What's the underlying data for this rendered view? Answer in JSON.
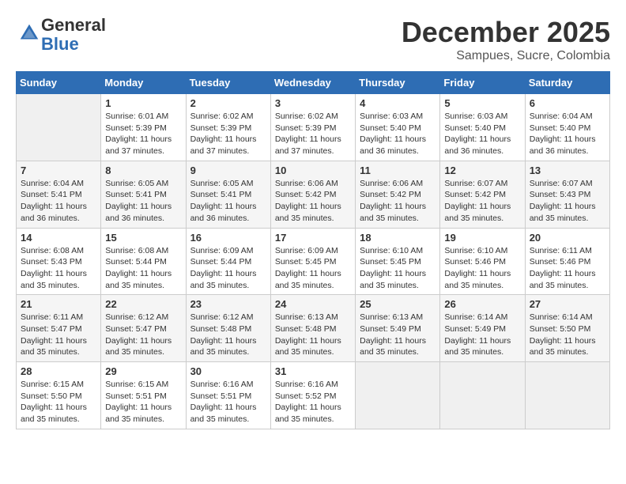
{
  "header": {
    "logo_line1": "General",
    "logo_line2": "Blue",
    "month_title": "December 2025",
    "location": "Sampues, Sucre, Colombia"
  },
  "days_of_week": [
    "Sunday",
    "Monday",
    "Tuesday",
    "Wednesday",
    "Thursday",
    "Friday",
    "Saturday"
  ],
  "weeks": [
    [
      {
        "day": "",
        "sunrise": "",
        "sunset": "",
        "daylight": ""
      },
      {
        "day": "1",
        "sunrise": "Sunrise: 6:01 AM",
        "sunset": "Sunset: 5:39 PM",
        "daylight": "Daylight: 11 hours and 37 minutes."
      },
      {
        "day": "2",
        "sunrise": "Sunrise: 6:02 AM",
        "sunset": "Sunset: 5:39 PM",
        "daylight": "Daylight: 11 hours and 37 minutes."
      },
      {
        "day": "3",
        "sunrise": "Sunrise: 6:02 AM",
        "sunset": "Sunset: 5:39 PM",
        "daylight": "Daylight: 11 hours and 37 minutes."
      },
      {
        "day": "4",
        "sunrise": "Sunrise: 6:03 AM",
        "sunset": "Sunset: 5:40 PM",
        "daylight": "Daylight: 11 hours and 36 minutes."
      },
      {
        "day": "5",
        "sunrise": "Sunrise: 6:03 AM",
        "sunset": "Sunset: 5:40 PM",
        "daylight": "Daylight: 11 hours and 36 minutes."
      },
      {
        "day": "6",
        "sunrise": "Sunrise: 6:04 AM",
        "sunset": "Sunset: 5:40 PM",
        "daylight": "Daylight: 11 hours and 36 minutes."
      }
    ],
    [
      {
        "day": "7",
        "sunrise": "Sunrise: 6:04 AM",
        "sunset": "Sunset: 5:41 PM",
        "daylight": "Daylight: 11 hours and 36 minutes."
      },
      {
        "day": "8",
        "sunrise": "Sunrise: 6:05 AM",
        "sunset": "Sunset: 5:41 PM",
        "daylight": "Daylight: 11 hours and 36 minutes."
      },
      {
        "day": "9",
        "sunrise": "Sunrise: 6:05 AM",
        "sunset": "Sunset: 5:41 PM",
        "daylight": "Daylight: 11 hours and 36 minutes."
      },
      {
        "day": "10",
        "sunrise": "Sunrise: 6:06 AM",
        "sunset": "Sunset: 5:42 PM",
        "daylight": "Daylight: 11 hours and 35 minutes."
      },
      {
        "day": "11",
        "sunrise": "Sunrise: 6:06 AM",
        "sunset": "Sunset: 5:42 PM",
        "daylight": "Daylight: 11 hours and 35 minutes."
      },
      {
        "day": "12",
        "sunrise": "Sunrise: 6:07 AM",
        "sunset": "Sunset: 5:42 PM",
        "daylight": "Daylight: 11 hours and 35 minutes."
      },
      {
        "day": "13",
        "sunrise": "Sunrise: 6:07 AM",
        "sunset": "Sunset: 5:43 PM",
        "daylight": "Daylight: 11 hours and 35 minutes."
      }
    ],
    [
      {
        "day": "14",
        "sunrise": "Sunrise: 6:08 AM",
        "sunset": "Sunset: 5:43 PM",
        "daylight": "Daylight: 11 hours and 35 minutes."
      },
      {
        "day": "15",
        "sunrise": "Sunrise: 6:08 AM",
        "sunset": "Sunset: 5:44 PM",
        "daylight": "Daylight: 11 hours and 35 minutes."
      },
      {
        "day": "16",
        "sunrise": "Sunrise: 6:09 AM",
        "sunset": "Sunset: 5:44 PM",
        "daylight": "Daylight: 11 hours and 35 minutes."
      },
      {
        "day": "17",
        "sunrise": "Sunrise: 6:09 AM",
        "sunset": "Sunset: 5:45 PM",
        "daylight": "Daylight: 11 hours and 35 minutes."
      },
      {
        "day": "18",
        "sunrise": "Sunrise: 6:10 AM",
        "sunset": "Sunset: 5:45 PM",
        "daylight": "Daylight: 11 hours and 35 minutes."
      },
      {
        "day": "19",
        "sunrise": "Sunrise: 6:10 AM",
        "sunset": "Sunset: 5:46 PM",
        "daylight": "Daylight: 11 hours and 35 minutes."
      },
      {
        "day": "20",
        "sunrise": "Sunrise: 6:11 AM",
        "sunset": "Sunset: 5:46 PM",
        "daylight": "Daylight: 11 hours and 35 minutes."
      }
    ],
    [
      {
        "day": "21",
        "sunrise": "Sunrise: 6:11 AM",
        "sunset": "Sunset: 5:47 PM",
        "daylight": "Daylight: 11 hours and 35 minutes."
      },
      {
        "day": "22",
        "sunrise": "Sunrise: 6:12 AM",
        "sunset": "Sunset: 5:47 PM",
        "daylight": "Daylight: 11 hours and 35 minutes."
      },
      {
        "day": "23",
        "sunrise": "Sunrise: 6:12 AM",
        "sunset": "Sunset: 5:48 PM",
        "daylight": "Daylight: 11 hours and 35 minutes."
      },
      {
        "day": "24",
        "sunrise": "Sunrise: 6:13 AM",
        "sunset": "Sunset: 5:48 PM",
        "daylight": "Daylight: 11 hours and 35 minutes."
      },
      {
        "day": "25",
        "sunrise": "Sunrise: 6:13 AM",
        "sunset": "Sunset: 5:49 PM",
        "daylight": "Daylight: 11 hours and 35 minutes."
      },
      {
        "day": "26",
        "sunrise": "Sunrise: 6:14 AM",
        "sunset": "Sunset: 5:49 PM",
        "daylight": "Daylight: 11 hours and 35 minutes."
      },
      {
        "day": "27",
        "sunrise": "Sunrise: 6:14 AM",
        "sunset": "Sunset: 5:50 PM",
        "daylight": "Daylight: 11 hours and 35 minutes."
      }
    ],
    [
      {
        "day": "28",
        "sunrise": "Sunrise: 6:15 AM",
        "sunset": "Sunset: 5:50 PM",
        "daylight": "Daylight: 11 hours and 35 minutes."
      },
      {
        "day": "29",
        "sunrise": "Sunrise: 6:15 AM",
        "sunset": "Sunset: 5:51 PM",
        "daylight": "Daylight: 11 hours and 35 minutes."
      },
      {
        "day": "30",
        "sunrise": "Sunrise: 6:16 AM",
        "sunset": "Sunset: 5:51 PM",
        "daylight": "Daylight: 11 hours and 35 minutes."
      },
      {
        "day": "31",
        "sunrise": "Sunrise: 6:16 AM",
        "sunset": "Sunset: 5:52 PM",
        "daylight": "Daylight: 11 hours and 35 minutes."
      },
      {
        "day": "",
        "sunrise": "",
        "sunset": "",
        "daylight": ""
      },
      {
        "day": "",
        "sunrise": "",
        "sunset": "",
        "daylight": ""
      },
      {
        "day": "",
        "sunrise": "",
        "sunset": "",
        "daylight": ""
      }
    ]
  ]
}
